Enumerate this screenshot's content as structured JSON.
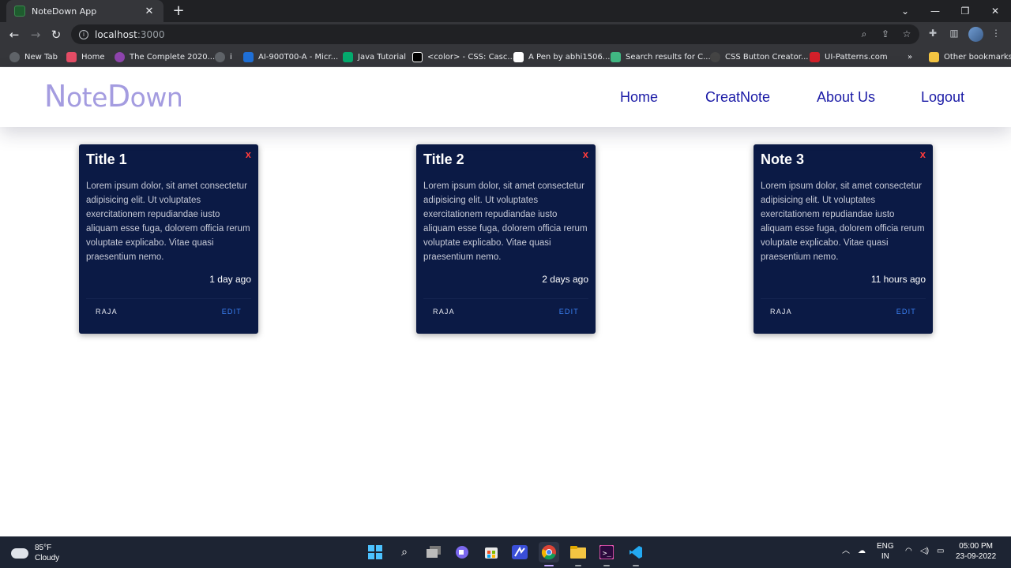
{
  "browser": {
    "tab_title": "NoteDown App",
    "url_host": "localhost",
    "url_port": ":3000",
    "bookmarks": [
      {
        "label": "New Tab",
        "color": "#5f6368"
      },
      {
        "label": "Home",
        "color": "#e44c65"
      },
      {
        "label": "The Complete 2020...",
        "color": "#8e44ad"
      },
      {
        "label": "i",
        "color": "#5f6368"
      },
      {
        "label": "AI-900T00-A - Micr...",
        "color": "#1f6fd6"
      },
      {
        "label": "Java Tutorial",
        "color": "#04aa6d"
      },
      {
        "label": "<color> - CSS: Casc...",
        "color": "#000000"
      },
      {
        "label": "A Pen by abhi1506...",
        "color": "#ffffff"
      },
      {
        "label": "Search results for C...",
        "color": "#41b883"
      },
      {
        "label": "CSS Button Creator...",
        "color": "#444444"
      },
      {
        "label": "UI-Patterns.com",
        "color": "#d4202a"
      }
    ],
    "bookmarks_more": "»",
    "other_bookmarks": "Other bookmarks"
  },
  "app": {
    "logo": {
      "n": "N",
      "ote": "ote",
      "d": "D",
      "own": "own"
    },
    "nav": [
      "Home",
      "CreatNote",
      "About Us",
      "Logout"
    ]
  },
  "notes": [
    {
      "title": "Title 1",
      "close": "x",
      "body": "Lorem ipsum dolor, sit amet consectetur adipisicing elit. Ut voluptates exercitationem repudiandae iusto aliquam esse fuga, dolorem officia rerum voluptate explicabo. Vitae quasi praesentium nemo.",
      "time": "1 day ago",
      "author": "RAJA",
      "edit": "EDIT"
    },
    {
      "title": "Title 2",
      "close": "x",
      "body": "Lorem ipsum dolor, sit amet consectetur adipisicing elit. Ut voluptates exercitationem repudiandae iusto aliquam esse fuga, dolorem officia rerum voluptate explicabo. Vitae quasi praesentium nemo.",
      "time": "2 days ago",
      "author": "RAJA",
      "edit": "EDIT"
    },
    {
      "title": "Note 3",
      "close": "x",
      "body": "Lorem ipsum dolor, sit amet consectetur adipisicing elit. Ut voluptates exercitationem repudiandae iusto aliquam esse fuga, dolorem officia rerum voluptate explicabo. Vitae quasi praesentium nemo.",
      "time": "11 hours ago",
      "author": "RAJA",
      "edit": "EDIT"
    }
  ],
  "taskbar": {
    "weather_temp": "85°F",
    "weather_desc": "Cloudy",
    "lang_1": "ENG",
    "lang_2": "IN",
    "time": "05:00 PM",
    "date": "23-09-2022"
  },
  "colors": {
    "card_bg": "#0b1a45",
    "nav_link": "#1a1aa6",
    "logo": "#a49ce0",
    "close_x": "#ff3b3b",
    "edit_link": "#3b82f6"
  }
}
